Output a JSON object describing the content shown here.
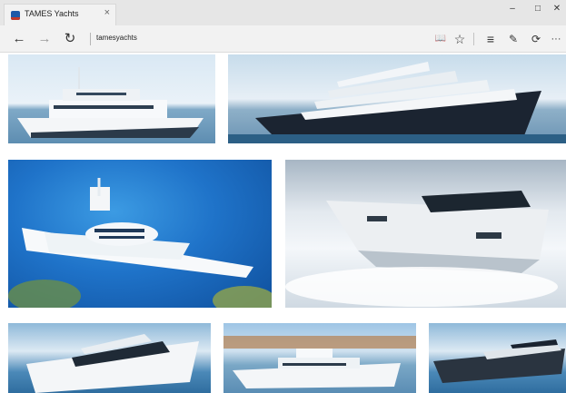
{
  "browser": {
    "tab_title": "TAMES Yachts",
    "tab_close": "×",
    "address": "tamesyachts",
    "window_controls": {
      "minimize": "–",
      "maximize": "□",
      "close": "✕"
    },
    "nav": {
      "back": "←",
      "forward": "→",
      "refresh": "↻"
    },
    "toolbar": {
      "reading_view": "📖",
      "favorite": "☆",
      "hub": "≡",
      "web_note": "✎",
      "share": "⟳",
      "more": "···"
    }
  },
  "gallery": {
    "images": [
      "white-motor-yacht",
      "dark-hull-superyacht",
      "futuristic-white-yacht",
      "speedboat-spray",
      "sport-yacht",
      "cruiser-yacht",
      "dark-sport-boat"
    ]
  }
}
